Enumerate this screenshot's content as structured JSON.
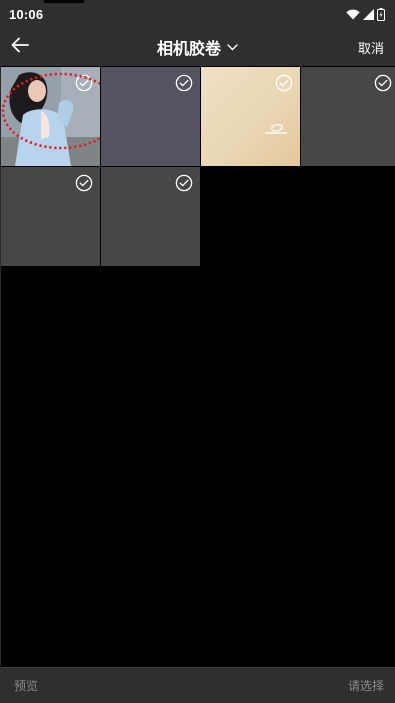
{
  "status_bar": {
    "time": "10:06",
    "icons": [
      "wifi-icon",
      "signal-icon",
      "battery-icon"
    ]
  },
  "header": {
    "back_icon": "arrow-left-icon",
    "album_title": "相机胶卷",
    "dropdown_icon": "chevron-down-icon",
    "cancel_label": "取消"
  },
  "grid": {
    "items": [
      {
        "kind": "photo-person",
        "selected_mark": "check-circle-icon",
        "annotated": true
      },
      {
        "kind": "solid-violet-gray",
        "selected_mark": "check-circle-icon"
      },
      {
        "kind": "beige-texture",
        "selected_mark": "check-circle-icon"
      },
      {
        "kind": "solid-gray",
        "selected_mark": "check-circle-icon"
      },
      {
        "kind": "solid-gray",
        "selected_mark": "check-circle-icon"
      },
      {
        "kind": "solid-gray",
        "selected_mark": "check-circle-icon"
      }
    ]
  },
  "bottom_bar": {
    "preview_label": "预览",
    "select_label": "请选择"
  },
  "colors": {
    "bar_background": "#2f2f30",
    "page_background": "#000000",
    "annotation_red": "#e02020"
  }
}
